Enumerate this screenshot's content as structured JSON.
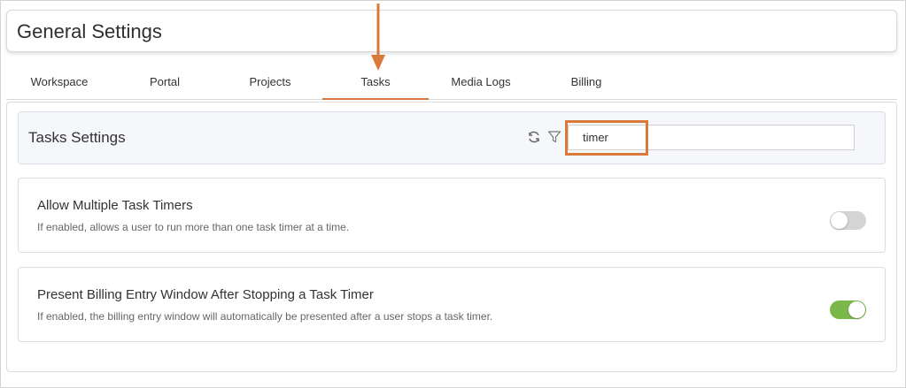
{
  "page": {
    "title": "General Settings"
  },
  "tabs": [
    {
      "label": "Workspace"
    },
    {
      "label": "Portal"
    },
    {
      "label": "Projects"
    },
    {
      "label": "Tasks",
      "active": true
    },
    {
      "label": "Media Logs"
    },
    {
      "label": "Billing"
    }
  ],
  "section": {
    "title": "Tasks Settings",
    "search_value": "timer",
    "icons": [
      "refresh-icon",
      "filter-icon"
    ]
  },
  "settings": [
    {
      "title": "Allow Multiple Task Timers",
      "description": "If enabled, allows a user to run more than one task timer at a time.",
      "enabled": false
    },
    {
      "title": "Present Billing Entry Window After Stopping a Task Timer",
      "description": "If enabled, the billing entry window will automatically be presented after a user stops a task timer.",
      "enabled": true
    }
  ],
  "colors": {
    "accent": "#d97a3a",
    "toggle_on": "#7ab84a",
    "toggle_off": "#d4d4d4"
  }
}
